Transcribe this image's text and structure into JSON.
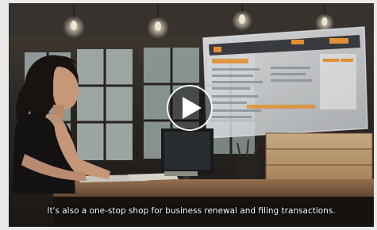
{
  "video": {
    "caption": "It's also a one-stop shop for business renewal and filing transactions.",
    "play_icon": "play-icon",
    "colors": {
      "overlay_ui_accent": "#f39c3a",
      "overlay_ui_bg": "#f2f4f6"
    }
  }
}
